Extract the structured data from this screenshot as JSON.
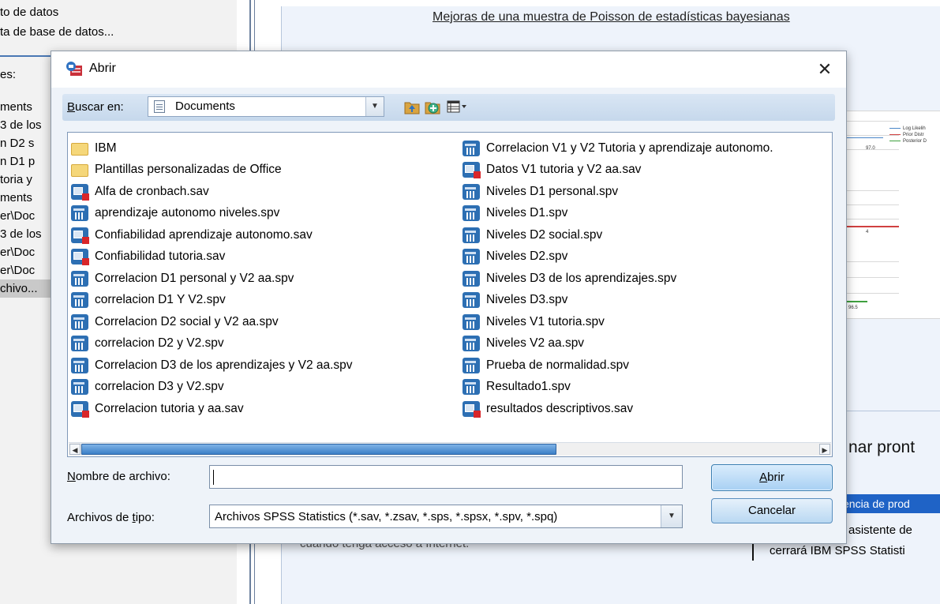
{
  "background": {
    "menu_items": [
      "to de datos",
      "ta de base de datos..."
    ],
    "left_heading": "es:",
    "left_list": [
      "ments",
      "3 de los",
      "n D2 s",
      "n D1 p",
      "toria y",
      "ments",
      "er\\Doc",
      "3 de los",
      "er\\Doc",
      "er\\Doc",
      "chivo..."
    ],
    "viewer_title": "Mejoras de una muestra de Poisson de estadísticas bayesianas",
    "chart_legend": [
      "Log Likelih",
      "Prior Distr",
      "Posterior D"
    ],
    "chart_labels": [
      "97.0",
      "4",
      "96.5"
    ],
    "prompt_text": "nar pront",
    "blue_button_text": "encia de prod",
    "text_line1": "asistente de",
    "text_line2": "cerrará IBM SPSS Statisti",
    "obscured_text": "cuando tenga acceso a Internet."
  },
  "dialog": {
    "title": "Abrir",
    "close_symbol": "✕",
    "look_in_label_accel": "B",
    "look_in_label_rest": "uscar en:",
    "look_in_value": "Documents",
    "files_col1": [
      {
        "name": "IBM",
        "type": "folder"
      },
      {
        "name": "Plantillas personalizadas de Office",
        "type": "folder"
      },
      {
        "name": "Alfa de cronbach.sav",
        "type": "sav"
      },
      {
        "name": "aprendizaje autonomo niveles.spv",
        "type": "spv"
      },
      {
        "name": "Confiabilidad aprendizaje autonomo.sav",
        "type": "sav"
      },
      {
        "name": "Confiabilidad tutoria.sav",
        "type": "sav"
      },
      {
        "name": "Correlacion D1 personal y V2 aa.spv",
        "type": "spv"
      },
      {
        "name": "correlacion D1 Y V2.spv",
        "type": "spv"
      },
      {
        "name": "Correlacion D2 social y V2 aa.spv",
        "type": "spv"
      },
      {
        "name": "correlacion D2 y V2.spv",
        "type": "spv"
      },
      {
        "name": "Correlacion D3 de los aprendizajes y V2 aa.spv",
        "type": "spv"
      },
      {
        "name": "correlacion D3 y V2.spv",
        "type": "spv"
      },
      {
        "name": "Correlacion tutoria y aa.sav",
        "type": "sav"
      }
    ],
    "files_col2": [
      {
        "name": "Correlacion V1 y V2 Tutoria y aprendizaje autonomo.",
        "type": "spv"
      },
      {
        "name": "Datos V1 tutoria y V2 aa.sav",
        "type": "sav"
      },
      {
        "name": "Niveles D1 personal.spv",
        "type": "spv"
      },
      {
        "name": "Niveles D1.spv",
        "type": "spv"
      },
      {
        "name": "Niveles D2 social.spv",
        "type": "spv"
      },
      {
        "name": "Niveles D2.spv",
        "type": "spv"
      },
      {
        "name": "Niveles D3 de los aprendizajes.spv",
        "type": "spv"
      },
      {
        "name": "Niveles D3.spv",
        "type": "spv"
      },
      {
        "name": "Niveles V1 tutoria.spv",
        "type": "spv"
      },
      {
        "name": "Niveles V2 aa.spv",
        "type": "spv"
      },
      {
        "name": "Prueba de normalidad.spv",
        "type": "spv"
      },
      {
        "name": "Resultado1.spv",
        "type": "spv"
      },
      {
        "name": "resultados descriptivos.sav",
        "type": "sav"
      }
    ],
    "filename_label_accel": "N",
    "filename_label_rest": "ombre de archivo:",
    "filename_value": "",
    "filetype_label_pre": "Archivos de ",
    "filetype_label_accel": "t",
    "filetype_label_post": "ipo:",
    "filetype_value": "Archivos SPSS Statistics (*.sav, *.zsav, *.sps, *.spsx, *.spv, *.spq)",
    "open_button_accel": "A",
    "open_button_rest": "brir",
    "cancel_button": "Cancelar"
  }
}
